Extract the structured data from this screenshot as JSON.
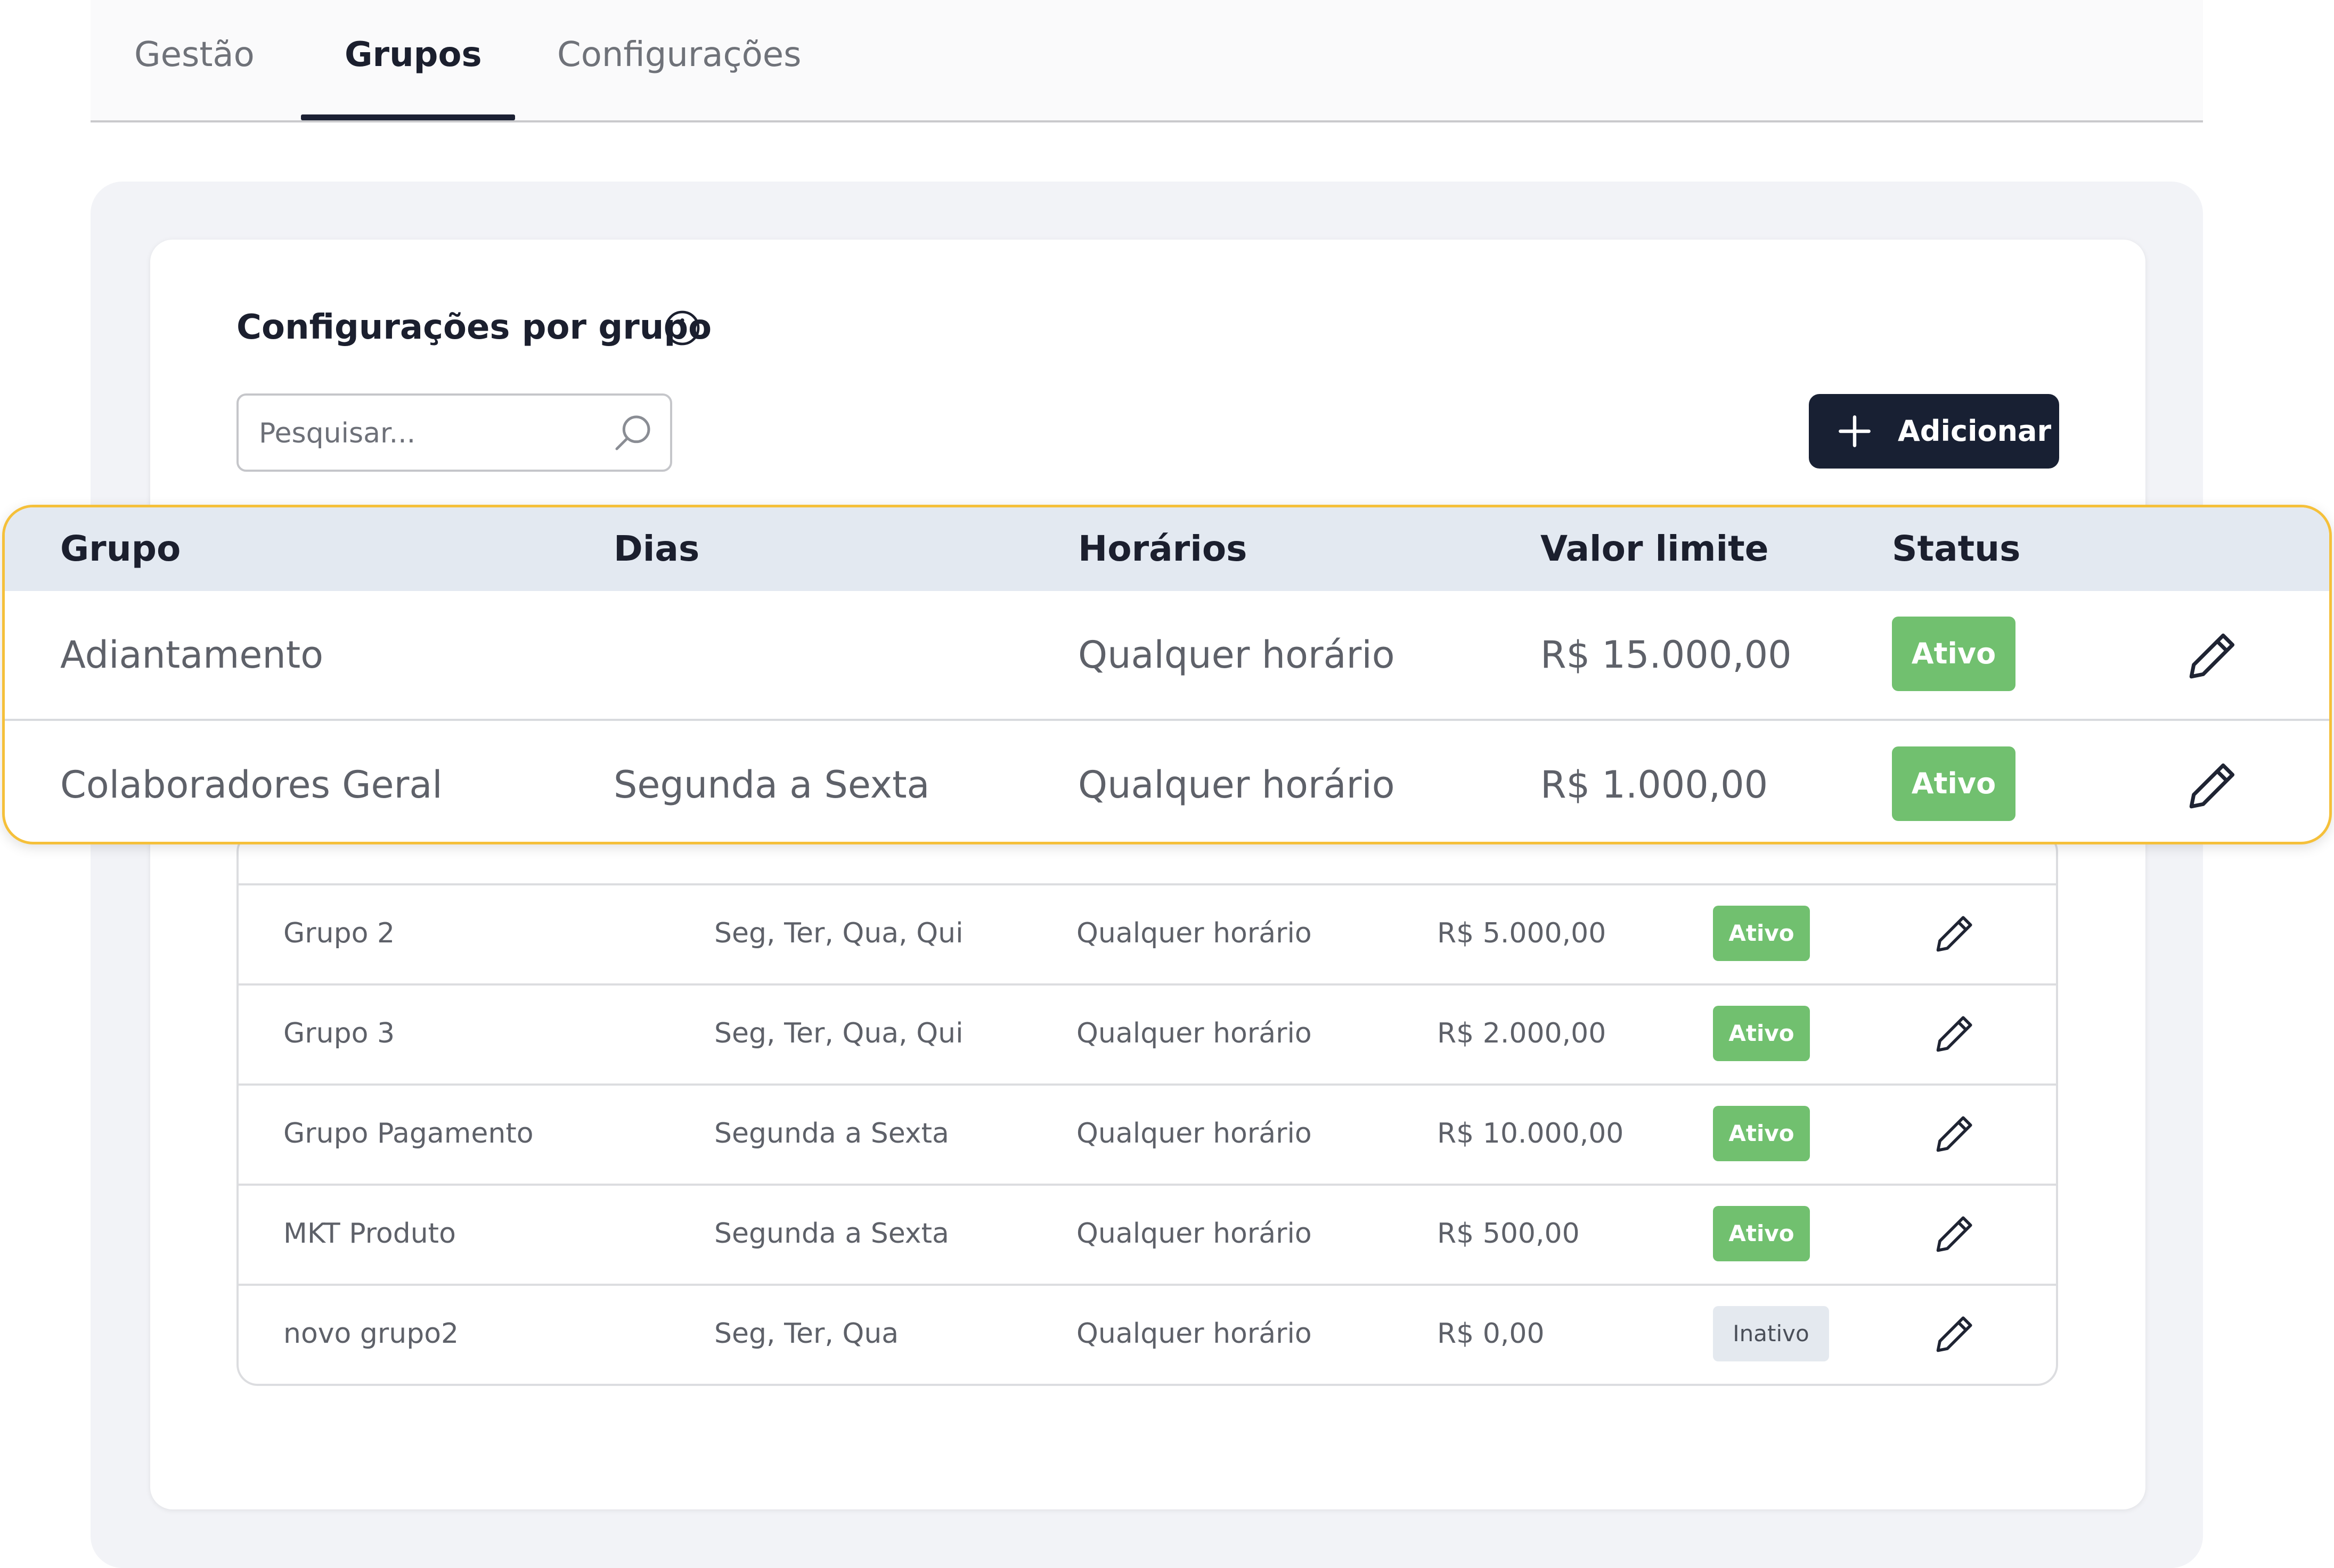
{
  "tabs": [
    {
      "label": "Gestão"
    },
    {
      "label": "Grupos"
    },
    {
      "label": "Configurações"
    }
  ],
  "active_tab": "Grupos",
  "section": {
    "title": "Configurações por grupo"
  },
  "search": {
    "placeholder": "Pesquisar..."
  },
  "add_button": {
    "label": "Adicionar"
  },
  "table": {
    "headers": [
      "Grupo",
      "Dias",
      "Horários",
      "Valor limite",
      "Status"
    ],
    "rows": [
      {
        "grupo": "Adiantamento",
        "dias": "",
        "horarios": "Qualquer horário",
        "valor": "R$ 15.000,00",
        "status": "Ativo"
      },
      {
        "grupo": "Colaboradores Geral",
        "dias": "Segunda a Sexta",
        "horarios": "Qualquer horário",
        "valor": "R$ 1.000,00",
        "status": "Ativo"
      },
      {
        "grupo": "Grupo 2",
        "dias": "Seg, Ter, Qua, Qui",
        "horarios": "Qualquer horário",
        "valor": "R$ 5.000,00",
        "status": "Ativo"
      },
      {
        "grupo": "Grupo 3",
        "dias": "Seg, Ter, Qua, Qui",
        "horarios": "Qualquer horário",
        "valor": "R$ 2.000,00",
        "status": "Ativo"
      },
      {
        "grupo": "Grupo Pagamento",
        "dias": "Segunda a Sexta",
        "horarios": "Qualquer horário",
        "valor": "R$ 10.000,00",
        "status": "Ativo"
      },
      {
        "grupo": "MKT Produto",
        "dias": "Segunda a Sexta",
        "horarios": "Qualquer horário",
        "valor": "R$ 500,00",
        "status": "Ativo"
      },
      {
        "grupo": "novo grupo2",
        "dias": "Seg, Ter, Qua",
        "horarios": "Qualquer horário",
        "valor": "R$ 0,00",
        "status": "Inativo"
      }
    ]
  },
  "colors": {
    "accent_dark": "#182033",
    "status_active": "#71c06f",
    "status_inactive": "#e4e9ef",
    "highlight_border": "#f5c03a"
  },
  "icons": [
    "info-icon",
    "search-icon",
    "plus-icon",
    "pencil-icon"
  ]
}
